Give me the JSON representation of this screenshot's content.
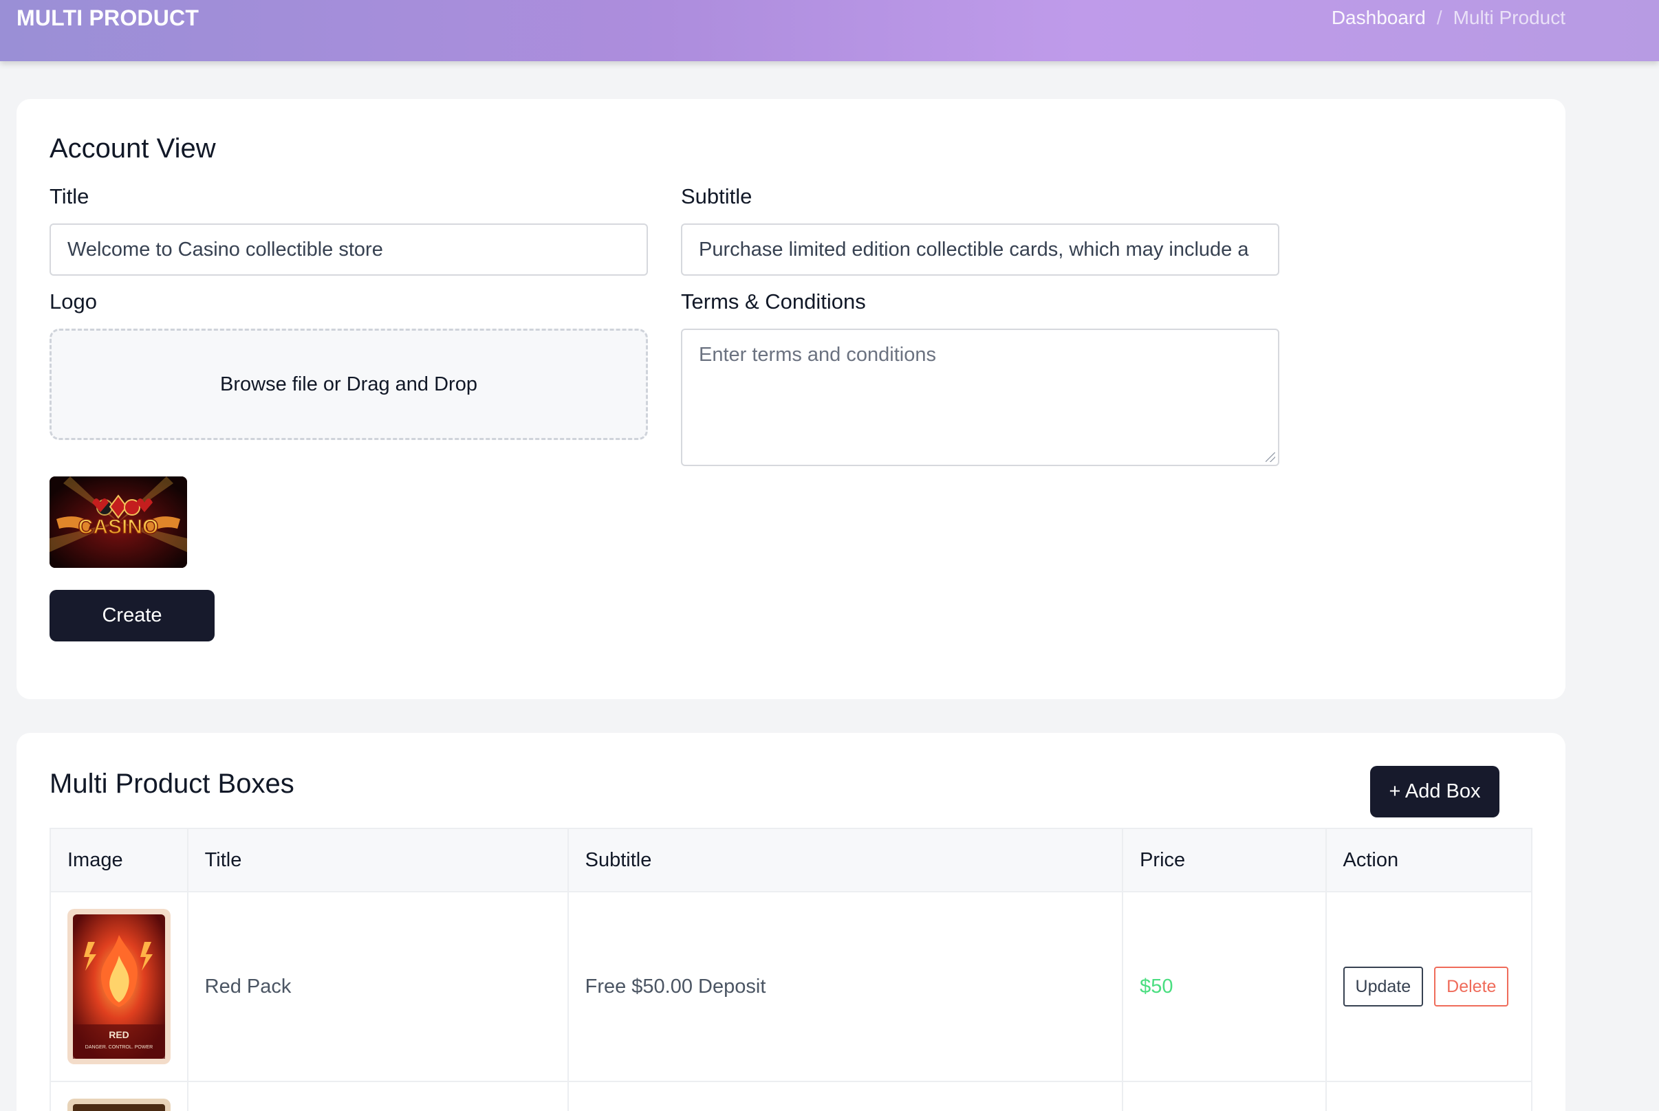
{
  "header": {
    "brand": "MULTI PRODUCT",
    "breadcrumb": [
      {
        "label": "Dashboard"
      },
      {
        "label": "Multi Product"
      }
    ],
    "separator": "/"
  },
  "account_view": {
    "title": "Account View",
    "fields": {
      "title_label": "Title",
      "title_value": "Welcome to Casino collectible store",
      "subtitle_label": "Subtitle",
      "subtitle_value": "Purchase limited edition collectible cards, which may include a",
      "logo_label": "Logo",
      "dropzone_text": "Browse file or Drag and Drop",
      "terms_label": "Terms & Conditions",
      "terms_placeholder": "Enter terms and conditions"
    },
    "logo_text": "CASINO",
    "create_button": "Create"
  },
  "boxes": {
    "title": "Multi Product Boxes",
    "add_button": "+ Add Box",
    "columns": [
      "Image",
      "Title",
      "Subtitle",
      "Price",
      "Action"
    ],
    "rows": [
      {
        "image_caption": "RED",
        "image_tagline": "DANGER. CONTROL. POWER",
        "title": "Red Pack",
        "subtitle": "Free $50.00 Deposit",
        "price": "$50",
        "update_label": "Update",
        "delete_label": "Delete"
      }
    ]
  },
  "colors": {
    "primary_dark": "#171a2c",
    "price_green": "#4ade80",
    "delete_red": "#ef6b5a",
    "header_gradient_start": "#9a8fd6",
    "header_gradient_end": "#b79be3"
  }
}
